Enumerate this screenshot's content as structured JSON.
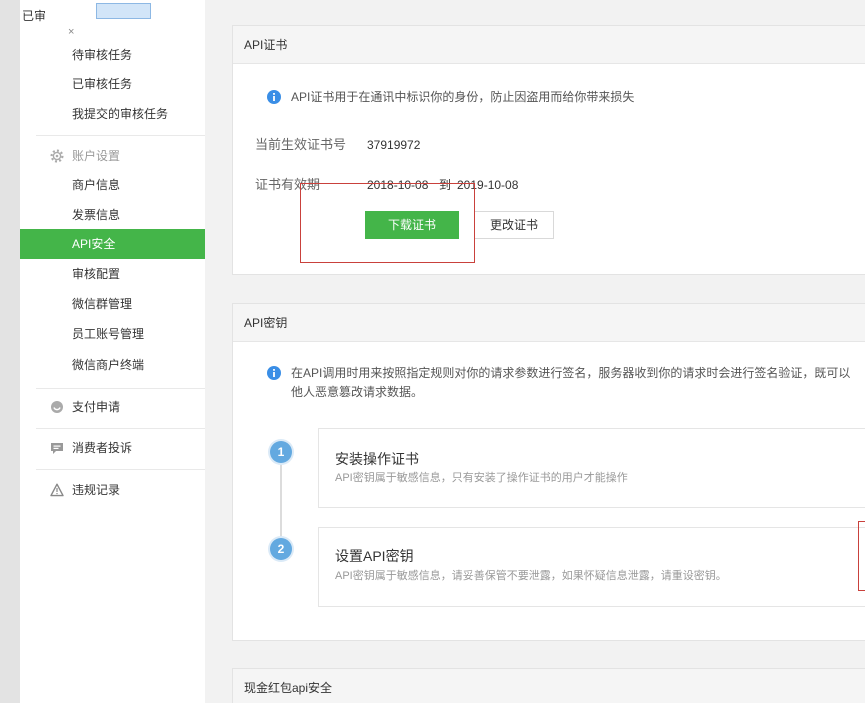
{
  "overlay": {
    "label": "已审",
    "close": "×"
  },
  "sidebar": {
    "review_items": [
      {
        "label": "待审核任务"
      },
      {
        "label": "已审核任务"
      },
      {
        "label": "我提交的审核任务"
      }
    ],
    "account_settings": {
      "title": "账户设置",
      "icon": "gear-icon",
      "items": [
        {
          "label": "商户信息",
          "active": false
        },
        {
          "label": "发票信息",
          "active": false
        },
        {
          "label": "API安全",
          "active": true
        },
        {
          "label": "审核配置",
          "active": false
        },
        {
          "label": "微信群管理",
          "active": false
        },
        {
          "label": "员工账号管理",
          "active": false
        },
        {
          "label": "微信商户终端",
          "active": false
        }
      ]
    },
    "payment_apply": {
      "label": "支付申请",
      "icon": "coin-icon"
    },
    "consumer_complaints": {
      "label": "消费者投诉",
      "icon": "chat-bubble-icon"
    },
    "violation_records": {
      "label": "违规记录",
      "icon": "warning-icon"
    }
  },
  "api_certificate": {
    "title": "API证书",
    "notice": "API证书用于在通讯中标识你的身份，防止因盗用而给你带来损失",
    "current_cert_label": "当前生效证书号",
    "current_cert_value": "37919972",
    "validity_label": "证书有效期",
    "valid_from": "2018-10-08",
    "to_word": "到",
    "valid_to": "2019-10-08",
    "download_button": "下载证书",
    "change_button": "更改证书"
  },
  "api_key": {
    "title": "API密钥",
    "notice_line1": "在API调用时用来按照指定规则对你的请求参数进行签名，服务器收到你的请求时会进行签名验证，既可以",
    "notice_line2": "他人恶意篡改请求数据。",
    "steps": [
      {
        "number": "1",
        "title": "安装操作证书",
        "desc": "API密钥属于敏感信息，只有安装了操作证书的用户才能操作"
      },
      {
        "number": "2",
        "title": "设置API密钥",
        "desc": "API密钥属于敏感信息，请妥善保管不要泄露，如果怀疑信息泄露，请重设密钥。"
      }
    ]
  },
  "redpack_security": {
    "title": "现金红包api安全"
  },
  "colors": {
    "accent_green": "#44b549",
    "info_blue": "#3a8ee6",
    "step_blue": "#63a9e0",
    "annotation_red": "#c9413c"
  }
}
